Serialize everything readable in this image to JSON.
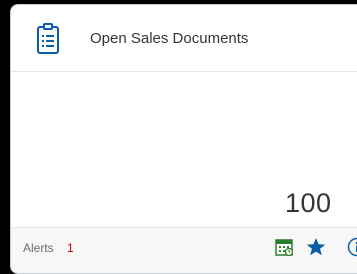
{
  "tile": {
    "title": "Open Sales Documents",
    "kpi_value": "100",
    "alerts_label": "Alerts",
    "alerts_count": "1",
    "icons": {
      "app": "clipboard-icon",
      "calendar": "calendar-icon",
      "favorite": "star-icon",
      "info": "info-icon"
    }
  },
  "colors": {
    "brand_blue": "#0a5ea6",
    "alert_red": "#bb0000",
    "calendar_green": "#2b7d2b"
  }
}
